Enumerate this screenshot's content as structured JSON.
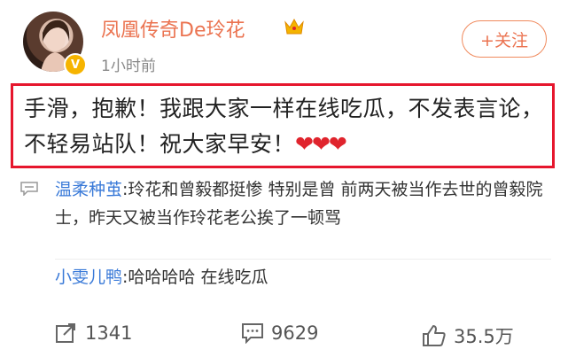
{
  "user": {
    "name": "凤凰传奇De玲花",
    "time": "1小时前",
    "follow_label": "+关注"
  },
  "post": {
    "text": "手滑，抱歉！我跟大家一样在线吃瓜，不发表言论，不轻易站队！祝大家早安！",
    "hearts": "❤❤❤"
  },
  "comments": [
    {
      "author": "温柔种茧",
      "text": ":玲花和曾毅都挺惨 特别是曾 前两天被当作去世的曾毅院士，昨天又被当作玲花老公挨了一顿骂"
    },
    {
      "author": "小雯儿鸭",
      "text": ":哈哈哈哈 在线吃瓜"
    }
  ],
  "actions": {
    "reposts": "1341",
    "comments": "9629",
    "likes": "35.5万"
  },
  "colors": {
    "username": "#eb7350",
    "highlight_border": "#e6162d",
    "comment_author": "#3a7ad8",
    "verified": "#f6b400"
  }
}
